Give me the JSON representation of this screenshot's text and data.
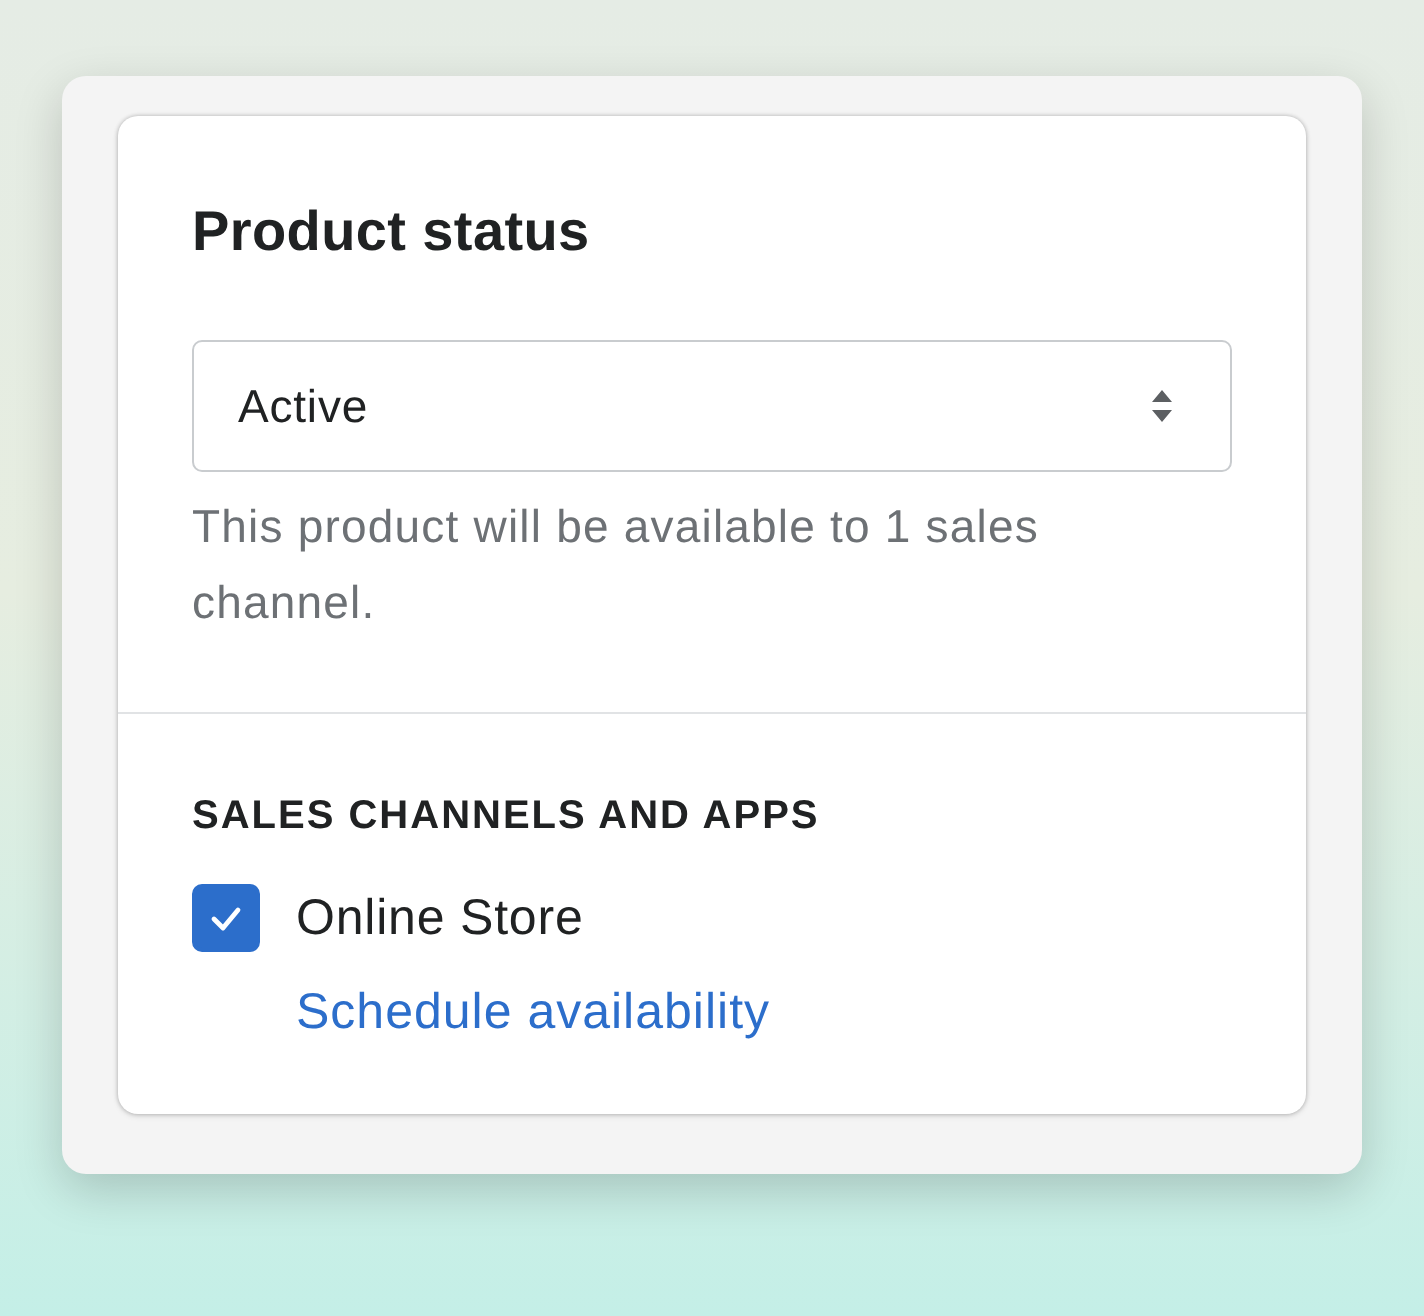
{
  "card": {
    "title": "Product status",
    "status_select": {
      "value": "Active"
    },
    "help_text": "This product will be available to 1 sales channel.",
    "section_heading": "SALES CHANNELS AND APPS",
    "channels": [
      {
        "label": "Online Store",
        "checked": true
      }
    ],
    "link": "Schedule availability"
  }
}
